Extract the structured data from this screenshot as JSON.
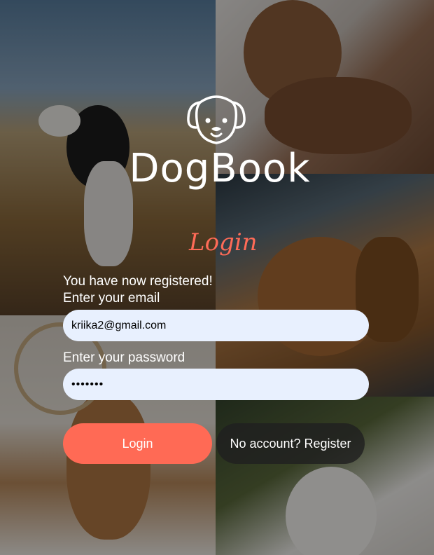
{
  "app": {
    "brand_name": "DogBook"
  },
  "login": {
    "heading": "Login",
    "status_message": "You have now registered!",
    "email_label": "Enter your email",
    "email_value": "kriika2@gmail.com",
    "password_label": "Enter your password",
    "password_value": "•••••••",
    "login_button": "Login",
    "register_button": "No account? Register"
  },
  "colors": {
    "accent": "#ff6a55",
    "input_background": "#e8f0fe",
    "secondary_button": "#202020"
  },
  "icons": {
    "logo": "dog-face-icon"
  }
}
